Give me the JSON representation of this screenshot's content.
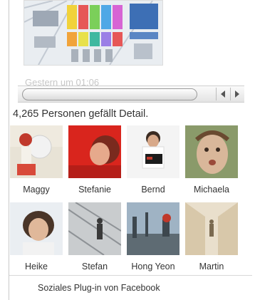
{
  "feed": {
    "map_image": "venue-floor-plan-map",
    "post_time": "Gestern um 01:06"
  },
  "likes": {
    "count_text": "4,265 Personen gefällt Detail."
  },
  "faces": [
    {
      "name": "Maggy"
    },
    {
      "name": "Stefanie"
    },
    {
      "name": "Bernd"
    },
    {
      "name": "Michaela"
    },
    {
      "name": "Heike"
    },
    {
      "name": "Stefan"
    },
    {
      "name": "Hong Yeon"
    },
    {
      "name": "Martin"
    }
  ],
  "footer": {
    "label": "Soziales Plug-in von Facebook"
  },
  "icons": {
    "scroll_left": "arrow-left-icon",
    "scroll_right": "arrow-right-icon"
  }
}
